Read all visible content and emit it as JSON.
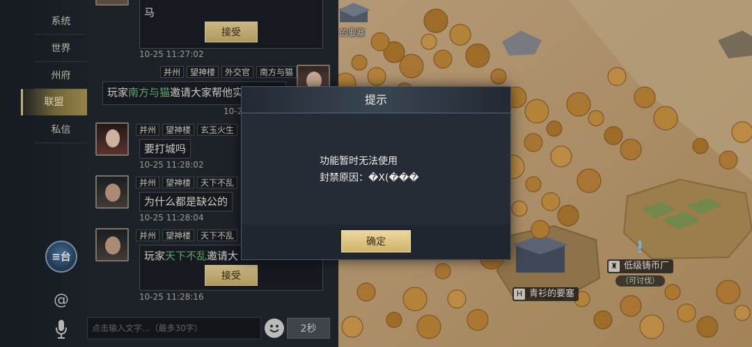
{
  "nav": {
    "items": [
      {
        "label": "系统"
      },
      {
        "label": "世界"
      },
      {
        "label": "州府"
      },
      {
        "label": "联盟"
      },
      {
        "label": "私信"
      }
    ],
    "active": "联盟",
    "emblem_text": "≡台",
    "at_icon": "@"
  },
  "chat": {
    "top_message": {
      "tail_text": "马",
      "accept_label": "接受",
      "time": "10-25 11:27:02"
    },
    "message_2": {
      "tags": [
        "并州",
        "望神楼",
        "外交官",
        "南方与猫"
      ],
      "prefix": "玩家",
      "player": "南方与猫",
      "text": "邀请大家帮他实",
      "time": "10-2"
    },
    "message_3": {
      "tags": [
        "并州",
        "望神楼",
        "玄玉火生"
      ],
      "text": "要打城吗",
      "time": "10-25 11:28:02"
    },
    "message_4": {
      "tags": [
        "并州",
        "望神楼",
        "天下不乱"
      ],
      "text": "为什么都是缺公的",
      "time": "10-25 11:28:04"
    },
    "message_5": {
      "tags": [
        "并州",
        "望神楼",
        "天下不乱"
      ],
      "prefix": "玩家",
      "player": "天下不乱",
      "text": "邀请大",
      "accept_label": "接受",
      "time": "10-25 11:28:16"
    },
    "input_placeholder": "点击输入文字...（最多30字）",
    "send_label": "2秒",
    "emoji_icon": "smiley-icon"
  },
  "dialog": {
    "title": "提示",
    "line1": "功能暂时无法使用",
    "line2": "封禁原因：�X(���",
    "ok_label": "确定"
  },
  "map": {
    "fort_top_label": "的要塞",
    "fort_label": "青衫的要塞",
    "fort_badge": "H",
    "mint_label": "低级铸币厂",
    "mint_sub": "（可讨伐）",
    "colors": {
      "sand": "#c9a77a",
      "tree": "#c88e3a",
      "hex": "#b7965f"
    }
  }
}
